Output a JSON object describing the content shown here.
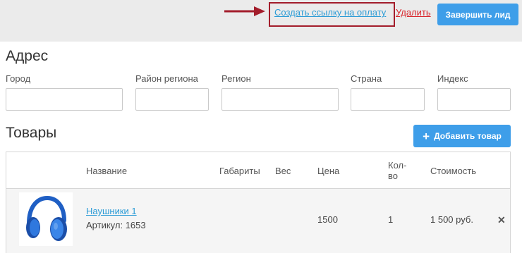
{
  "header": {
    "pay_link": "Создать ссылку на оплату",
    "delete_link": "Удалить",
    "finish_button": "Завершить лид"
  },
  "address": {
    "title": "Адрес",
    "fields": [
      {
        "label": "Город",
        "value": ""
      },
      {
        "label": "Район региона",
        "value": ""
      },
      {
        "label": "Регион",
        "value": ""
      },
      {
        "label": "Страна",
        "value": ""
      },
      {
        "label": "Индекс",
        "value": ""
      }
    ]
  },
  "goods": {
    "title": "Товары",
    "add_button": "Добавить товар",
    "columns": {
      "name": "Название",
      "dims": "Габариты",
      "weight": "Вес",
      "price": "Цена",
      "qty_line1": "Кол-",
      "qty_line2": "во",
      "cost": "Стоимость"
    },
    "rows": [
      {
        "name": "Наушники 1",
        "sku": "Артикул: 1653",
        "price": "1500",
        "qty": "1",
        "cost": "1 500 руб."
      }
    ]
  },
  "icons": {
    "arrow": "right-arrow-icon",
    "plus": "plus-icon",
    "remove": "close-icon",
    "product_image": "headphones-icon"
  },
  "colors": {
    "accent": "#3e9ee9",
    "link": "#2a9bd6",
    "danger": "#d9262c",
    "highlight": "#a31d2b"
  }
}
